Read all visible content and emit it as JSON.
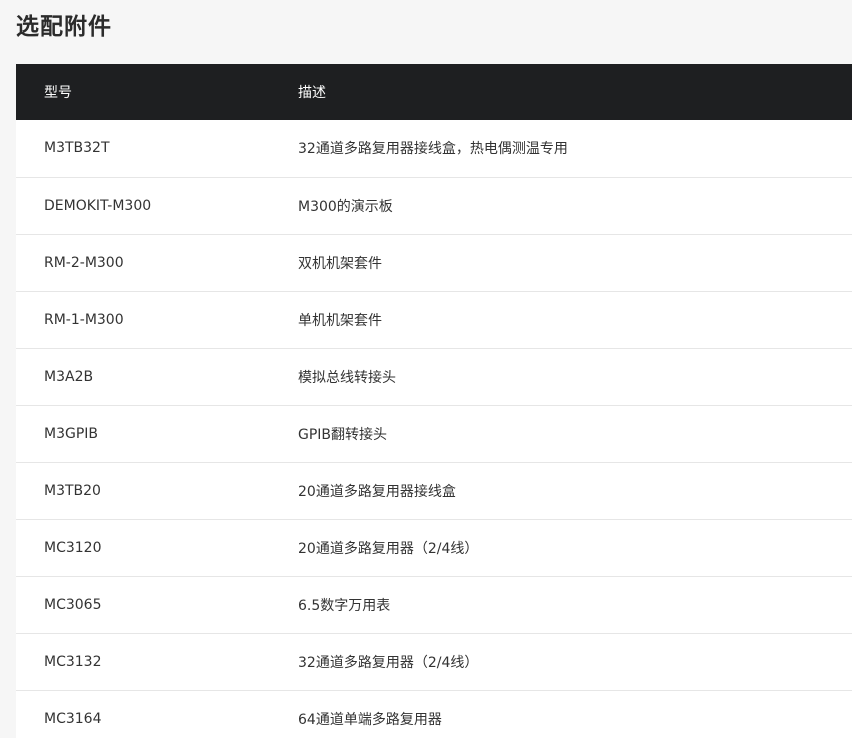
{
  "section": {
    "title": "选配附件"
  },
  "table": {
    "headers": {
      "model": "型号",
      "description": "描述"
    },
    "rows": [
      {
        "model": "M3TB32T",
        "description": "32通道多路复用器接线盒，热电偶测温专用"
      },
      {
        "model": "DEMOKIT-M300",
        "description": "M300的演示板"
      },
      {
        "model": "RM-2-M300",
        "description": "双机机架套件"
      },
      {
        "model": "RM-1-M300",
        "description": "单机机架套件"
      },
      {
        "model": "M3A2B",
        "description": "模拟总线转接头"
      },
      {
        "model": "M3GPIB",
        "description": "GPIB翻转接头"
      },
      {
        "model": "M3TB20",
        "description": "20通道多路复用器接线盒"
      },
      {
        "model": "MC3120",
        "description": "20通道多路复用器（2/4线）"
      },
      {
        "model": "MC3065",
        "description": "6.5数字万用表"
      },
      {
        "model": "MC3132",
        "description": "32通道多路复用器（2/4线）"
      },
      {
        "model": "MC3164",
        "description": "64通道单端多路复用器"
      }
    ]
  }
}
